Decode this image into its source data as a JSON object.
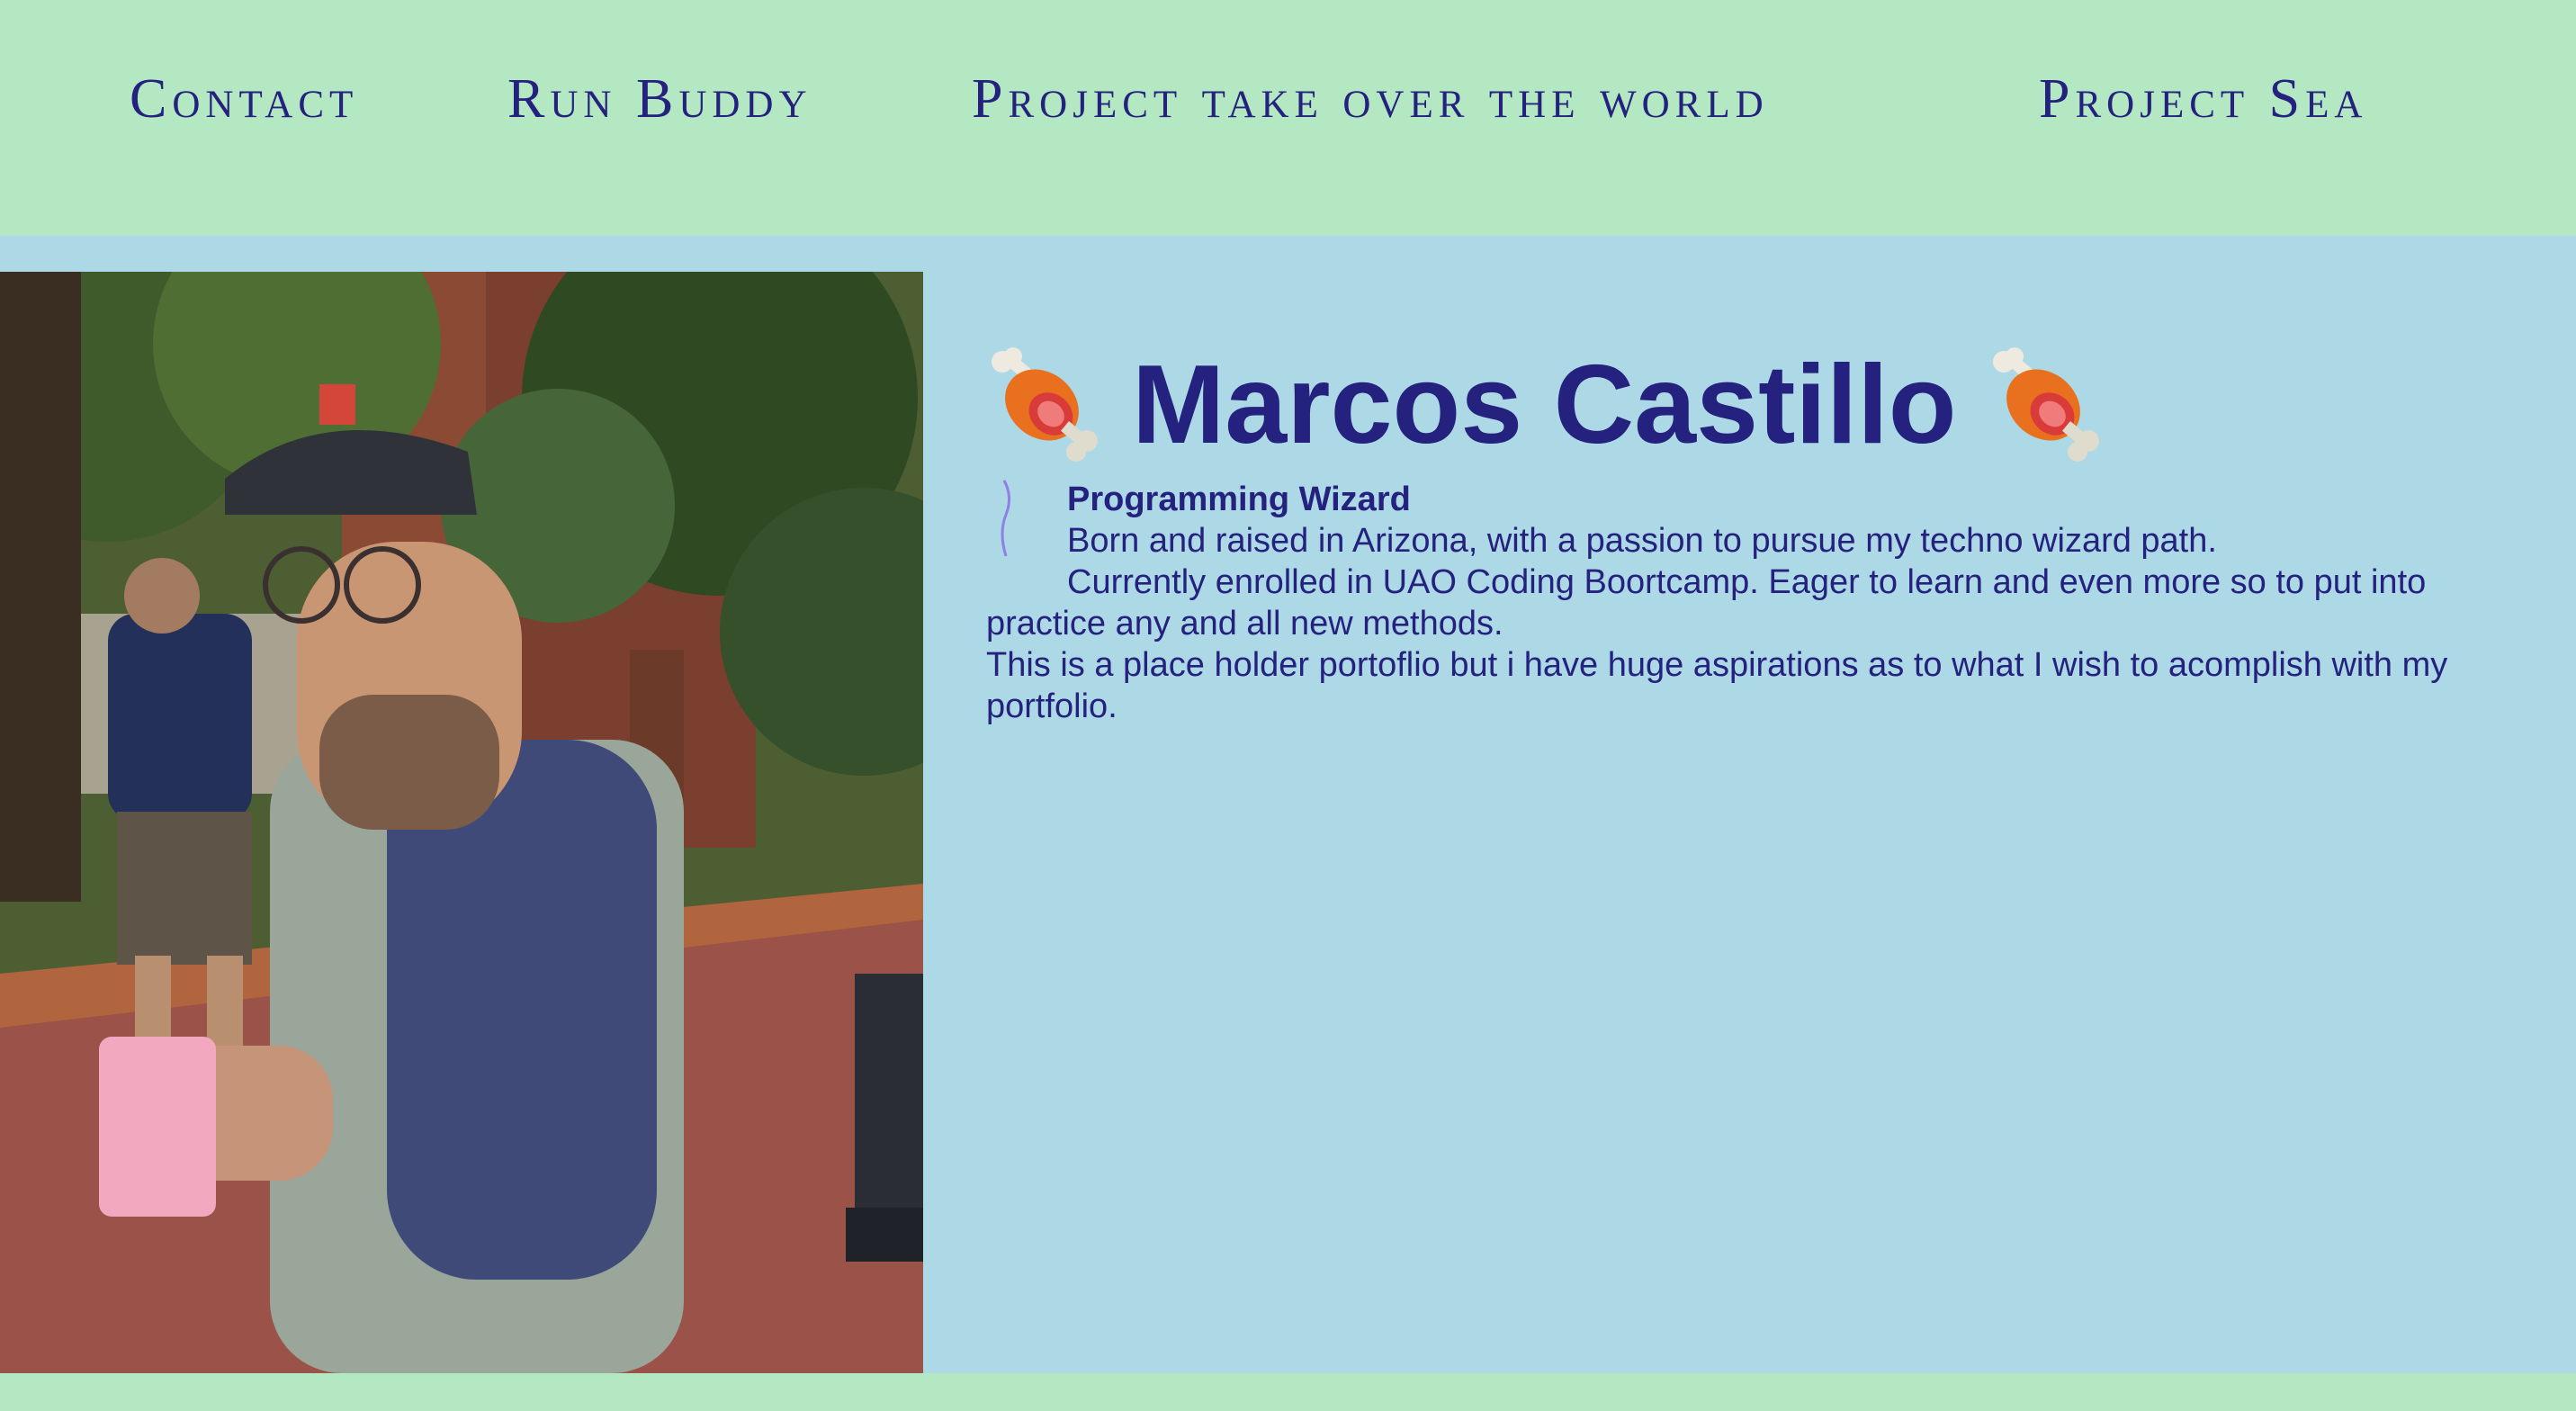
{
  "nav": {
    "items": [
      {
        "label": "Contact"
      },
      {
        "label": "Run Buddy"
      },
      {
        "label": "Project take over the world"
      },
      {
        "label": "Project Sea"
      }
    ]
  },
  "profile": {
    "name": "Marcos Castillo",
    "title": "Programming Wizard",
    "bio_line_1": "Born and raised in Arizona, with a passion to pursue my techno wizard path.",
    "bio_line_2": "Currently enrolled in UAO Coding Boortcamp. Eager to learn and even more so to put into practice any and all new methods.",
    "bio_line_3": "This is a place holder portoflio but i have huge aspirations as to what I wish to acomplish with my portfolio.",
    "title_icons": [
      "meat-on-bone-icon",
      "meat-on-bone-icon"
    ]
  },
  "colors": {
    "header_bg": "#b3e8c3",
    "main_bg": "#add8e6",
    "text": "#25217e"
  }
}
